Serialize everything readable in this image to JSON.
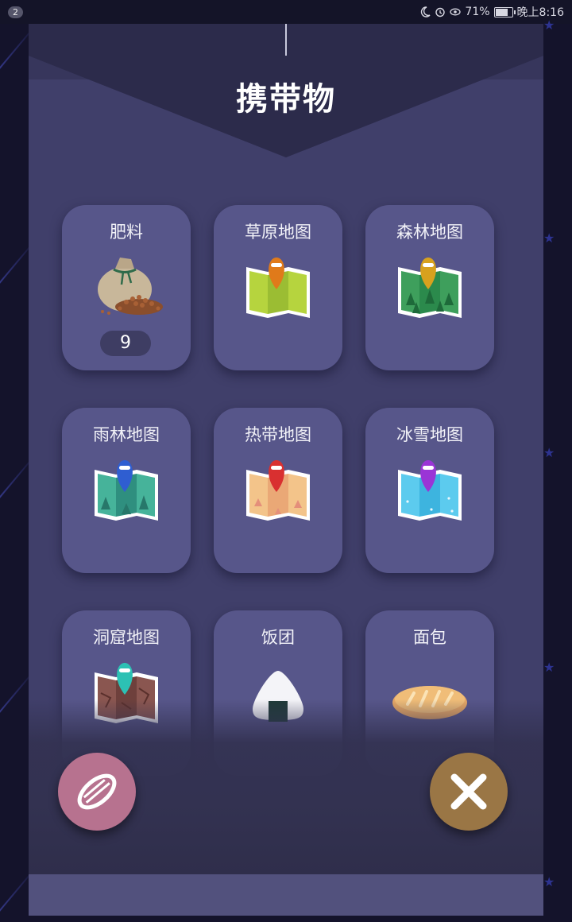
{
  "status_bar": {
    "notification_count": "2",
    "battery_percent": "71%",
    "time": "晚上8:16",
    "icons": [
      "moon-icon",
      "alarm-icon",
      "eye-icon",
      "battery-icon"
    ]
  },
  "panel": {
    "title": "携带物"
  },
  "items": [
    {
      "label": "肥料",
      "icon": "fertilizer-bag-icon",
      "count": "9"
    },
    {
      "label": "草原地图",
      "icon": "grassland-map-icon",
      "pin_color": "#e07a1a",
      "map_color": "#a6c43a"
    },
    {
      "label": "森林地图",
      "icon": "forest-map-icon",
      "pin_color": "#d7a11e",
      "map_color": "#2e8a4e"
    },
    {
      "label": "雨林地图",
      "icon": "rainforest-map-icon",
      "pin_color": "#2f5ed1",
      "map_color": "#3aa08c"
    },
    {
      "label": "热带地图",
      "icon": "tropical-map-icon",
      "pin_color": "#d93030",
      "map_color": "#efb87a"
    },
    {
      "label": "冰雪地图",
      "icon": "snow-map-icon",
      "pin_color": "#9a35d6",
      "map_color": "#4cc3e8"
    },
    {
      "label": "洞窟地图",
      "icon": "cave-map-icon",
      "pin_color": "#2cc1b4",
      "map_color": "#7a4a44"
    },
    {
      "label": "饭团",
      "icon": "rice-ball-icon"
    },
    {
      "label": "面包",
      "icon": "bread-icon"
    }
  ],
  "buttons": {
    "seed": {
      "icon": "seed-icon",
      "color": "#b7728f"
    },
    "close": {
      "icon": "close-icon",
      "color": "#9a7645"
    }
  }
}
